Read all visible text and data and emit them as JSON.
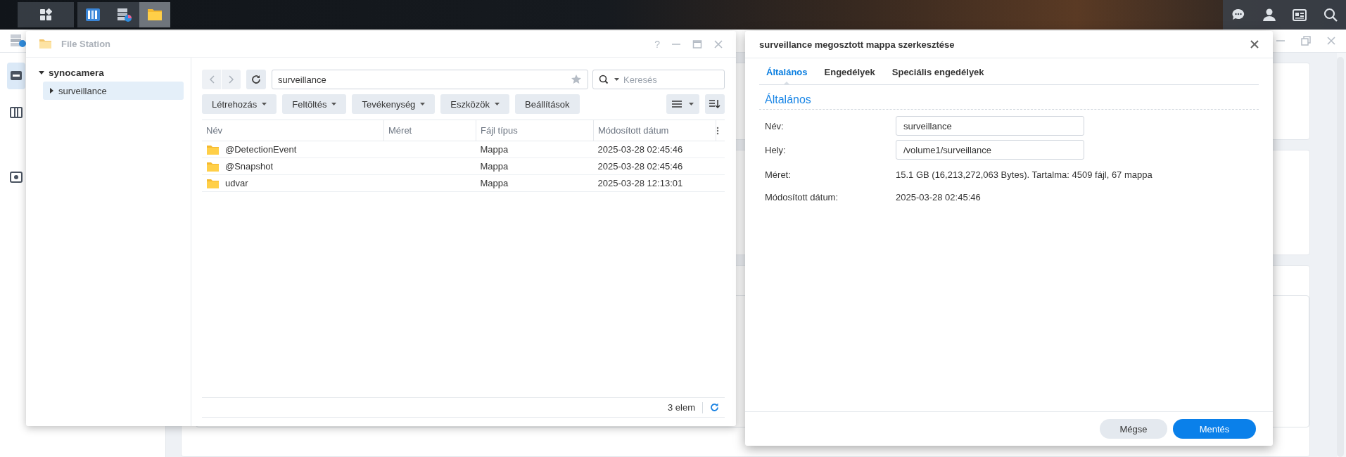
{
  "file_station": {
    "title": "File Station",
    "help_button": "?",
    "tree": [
      {
        "label": "synocamera",
        "expanded": true,
        "selected": false,
        "children": [
          {
            "label": "surveillance",
            "expanded": false,
            "selected": true
          }
        ]
      }
    ],
    "path": "surveillance",
    "search_placeholder": "Keresés",
    "toolbar": [
      {
        "label": "Létrehozás",
        "kind": "menu"
      },
      {
        "label": "Feltöltés",
        "kind": "menu"
      },
      {
        "label": "Tevékenység",
        "kind": "menu"
      },
      {
        "label": "Eszközök",
        "kind": "menu"
      },
      {
        "label": "Beállítások",
        "kind": "plain"
      }
    ],
    "columns": [
      "Név",
      "Méret",
      "Fájl típus",
      "Módosított dátum"
    ],
    "rows": [
      {
        "name": "@DetectionEvent",
        "type": "Mappa",
        "modified": "2025-03-28 02:45:46"
      },
      {
        "name": "@Snapshot",
        "type": "Mappa",
        "modified": "2025-03-28 02:45:46"
      },
      {
        "name": "udvar",
        "type": "Mappa",
        "modified": "2025-03-28 12:13:01"
      }
    ],
    "status": "3 elem"
  },
  "dialog": {
    "title": "surveillance megosztott mappa szerkesztése",
    "tabs": [
      {
        "label": "Általános",
        "selected": true
      },
      {
        "label": "Engedélyek",
        "selected": false
      },
      {
        "label": "Speciális engedélyek",
        "selected": false
      }
    ],
    "section": "Általános",
    "fields": [
      {
        "label": "Név:",
        "kind": "input",
        "value": "surveillance"
      },
      {
        "label": "Hely:",
        "kind": "input",
        "value": "/volume1/surveillance"
      },
      {
        "label": "Méret:",
        "kind": "text",
        "value": "15.1 GB (16,213,272,063 Bytes). Tartalma: 4509 fájl, 67 mappa"
      },
      {
        "label": "Módosított dátum:",
        "kind": "text",
        "value": "2025-03-28 02:45:46"
      }
    ],
    "buttons": [
      {
        "label": "Mégse",
        "kind": "secondary"
      },
      {
        "label": "Mentés",
        "kind": "primary"
      }
    ]
  }
}
